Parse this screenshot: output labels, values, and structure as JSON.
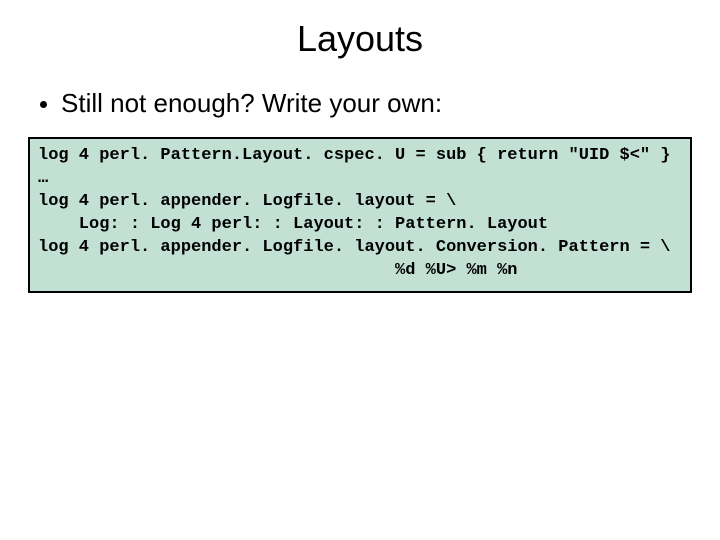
{
  "title": "Layouts",
  "bullet1": "Still not enough? Write your own:",
  "code": {
    "l1": "log 4 perl. Pattern.Layout. cspec. U = sub { return \"UID $<\" }",
    "l2": "…",
    "l3": "log 4 perl. appender. Logfile. layout = \\",
    "l4": "    Log: : Log 4 perl: : Layout: : Pattern. Layout",
    "l5": "log 4 perl. appender. Logfile. layout. Conversion. Pattern = \\",
    "l6": "                                   %d %U> %m %n"
  }
}
